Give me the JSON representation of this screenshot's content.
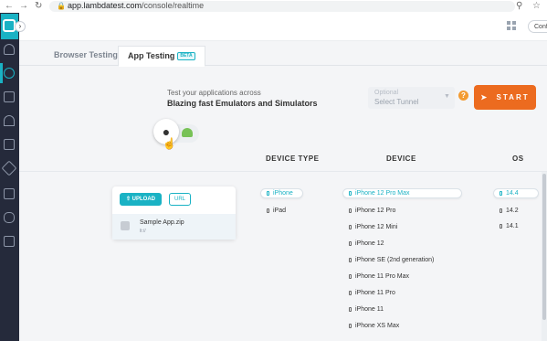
{
  "browser": {
    "url_host": "app.lambdatest.com",
    "url_path": "/console/realtime"
  },
  "header": {
    "config_label": "Confi"
  },
  "tabs": [
    {
      "label": "Browser Testing",
      "active": false
    },
    {
      "label": "App Testing",
      "active": true,
      "badge": "BETA"
    }
  ],
  "hero": {
    "subtitle": "Test your applications across",
    "title": "Blazing fast Emulators and Simulators"
  },
  "tunnel": {
    "label": "Optional",
    "placeholder": "Select Tunnel"
  },
  "start_label": "START",
  "os_toggle": {
    "options": [
      "ios",
      "android"
    ],
    "selected": "ios"
  },
  "upload": {
    "upload_label": "UPLOAD",
    "url_label": "URL",
    "app_name": "Sample App.zip",
    "app_id": "lt://"
  },
  "columns": {
    "device_type": "DEVICE TYPE",
    "device": "DEVICE",
    "os": "OS"
  },
  "device_types": [
    {
      "label": "iPhone",
      "selected": true
    },
    {
      "label": "iPad",
      "selected": false
    }
  ],
  "devices": [
    {
      "label": "iPhone 12 Pro Max",
      "selected": true
    },
    {
      "label": "iPhone 12 Pro",
      "selected": false
    },
    {
      "label": "iPhone 12 Mini",
      "selected": false
    },
    {
      "label": "iPhone 12",
      "selected": false
    },
    {
      "label": "iPhone SE (2nd generation)",
      "selected": false
    },
    {
      "label": "iPhone 11 Pro Max",
      "selected": false
    },
    {
      "label": "iPhone 11 Pro",
      "selected": false
    },
    {
      "label": "iPhone 11",
      "selected": false
    },
    {
      "label": "iPhone XS Max",
      "selected": false
    }
  ],
  "os_versions": [
    {
      "label": "14.4",
      "selected": true
    },
    {
      "label": "14.2",
      "selected": false
    },
    {
      "label": "14.1",
      "selected": false
    }
  ],
  "colors": {
    "accent": "#1ab2c4",
    "start": "#ec6b1f",
    "sidebar": "#252a3b"
  }
}
